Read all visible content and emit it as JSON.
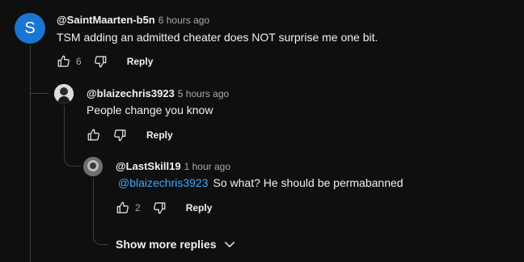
{
  "comments": [
    {
      "avatar_letter": "S",
      "avatar_color": "#1976d2",
      "handle": "@SaintMaarten-b5n",
      "time": "6 hours ago",
      "text": "TSM adding an admitted cheater does NOT surprise me one bit.",
      "likes": "6",
      "reply_label": "Reply"
    },
    {
      "handle": "@blaizechris3923",
      "time": "5 hours ago",
      "text": "People change you know",
      "likes": "",
      "reply_label": "Reply"
    },
    {
      "handle": "@LastSkill19",
      "time": "1 hour ago",
      "mention": "@blaizechris3923",
      "text": "So what? He should be permabanned",
      "likes": "2",
      "reply_label": "Reply"
    }
  ],
  "show_more_label": "Show more replies",
  "icons": {
    "like": "thumbs-up-icon",
    "dislike": "thumbs-down-icon",
    "expand": "chevron-down-icon"
  }
}
